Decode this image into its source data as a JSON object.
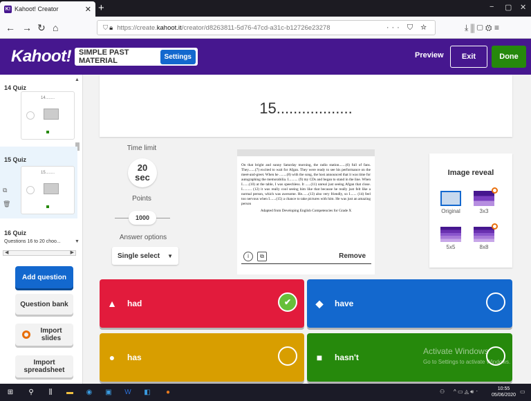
{
  "browser": {
    "tab_title": "Kahoot! Creator",
    "tab_favicon": "K!",
    "url_prefix": "https://create.",
    "url_host": "kahoot.it",
    "url_path": "/creator/d8263811-5d76-47cd-a31c-b12726e23278",
    "url_actions": "··· ⛉ ☆",
    "toolbar_icons": "⤓  ⫼  ▢  ⚙  ≡"
  },
  "header": {
    "logo": "Kahoot!",
    "title": "SIMPLE PAST MATERIAL",
    "settings": "Settings",
    "preview": "Preview",
    "exit": "Exit",
    "done": "Done"
  },
  "sidebar": {
    "items": [
      {
        "label": "14  Quiz",
        "thumb_title": "14........"
      },
      {
        "label": "15  Quiz",
        "thumb_title": "15........"
      },
      {
        "label": "16  Quiz",
        "sub": "Questions 16 to 20 choo..."
      }
    ],
    "add_question": "Add question",
    "question_bank": "Question bank",
    "import_slides": "Import slides",
    "import_spreadsheet": "Import spreadsheet"
  },
  "question": {
    "text": "15.................."
  },
  "settings": {
    "time_limit_label": "Time limit",
    "time_value": "20",
    "time_unit": "sec",
    "points_label": "Points",
    "points_value": "1000",
    "answer_options_label": "Answer options",
    "answer_options_value": "Single select"
  },
  "image": {
    "passage": "On that bright and sunny Saturday morning, the radio station.......(6) full of fans. They.......(7) excited to wait for Afgan. They were ready to see his performance on the meet-and-greet. When he ........(8) with the song, the host announced that it was time for autographing the memorabilia. I.......... (9) my CDs and began to stand in the line. When I.......(10) at the table, I was speechless. It ......(11) unreal just seeing Afgan that close. I.......... (12) it was really cool seeing him like that because he really just felt like a normal person, which was awesome. He.......(13) also very friendly, so I....... (14) feel too nervous when I.......(15) a chance to take pictures with him. He was just an amazing person",
    "source": "Adapted from Developing English Competencies for Grade X",
    "remove": "Remove"
  },
  "image_reveal": {
    "title": "Image reveal",
    "options": [
      "Original",
      "3x3",
      "5x5",
      "8x8"
    ]
  },
  "answers": [
    {
      "text": "had",
      "symbol": "triangle-icon",
      "correct": true,
      "color": "#e21b3c"
    },
    {
      "text": "have",
      "symbol": "diamond-icon",
      "correct": false,
      "color": "#1368ce"
    },
    {
      "text": "has",
      "symbol": "circle-icon",
      "correct": false,
      "color": "#d89e00"
    },
    {
      "text": "hasn't",
      "symbol": "square-icon",
      "correct": false,
      "color": "#26890c"
    }
  ],
  "watermark": {
    "line1": "Activate Windows",
    "line2": "Go to Settings to activate Windows."
  },
  "taskbar": {
    "time": "10:55",
    "date": "05/06/2020"
  },
  "colors": {
    "brand_purple": "#46178f",
    "blue": "#1368ce",
    "done_green": "#26890c"
  }
}
